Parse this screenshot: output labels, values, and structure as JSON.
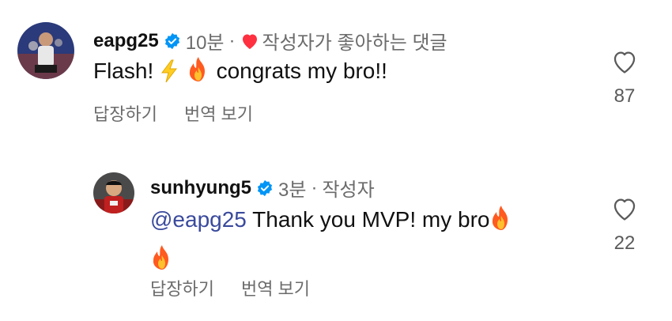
{
  "comments": [
    {
      "username": "eapg25",
      "time": "10분",
      "separator": "·",
      "liked_by_author_text": "작성자가 좋아하는 댓글",
      "text_before": "Flash!",
      "text_after": "congrats my bro!!",
      "emojis": [
        "lightning-emoji",
        "fire-emoji"
      ],
      "reply_label": "답장하기",
      "translate_label": "번역 보기",
      "like_count": "87"
    },
    {
      "username": "sunhyung5",
      "time": "3분",
      "separator": "·",
      "author_tag": "작성자",
      "mention": "@eapg25",
      "text": "Thank you MVP! my bro",
      "emojis": [
        "fire-emoji",
        "fire-emoji"
      ],
      "reply_label": "답장하기",
      "translate_label": "번역 보기",
      "like_count": "22"
    }
  ],
  "colors": {
    "verified": "#0095f6",
    "liked_heart": "#ff3040",
    "mention": "#3a4a9c",
    "muted_text": "#6b6b6b"
  }
}
